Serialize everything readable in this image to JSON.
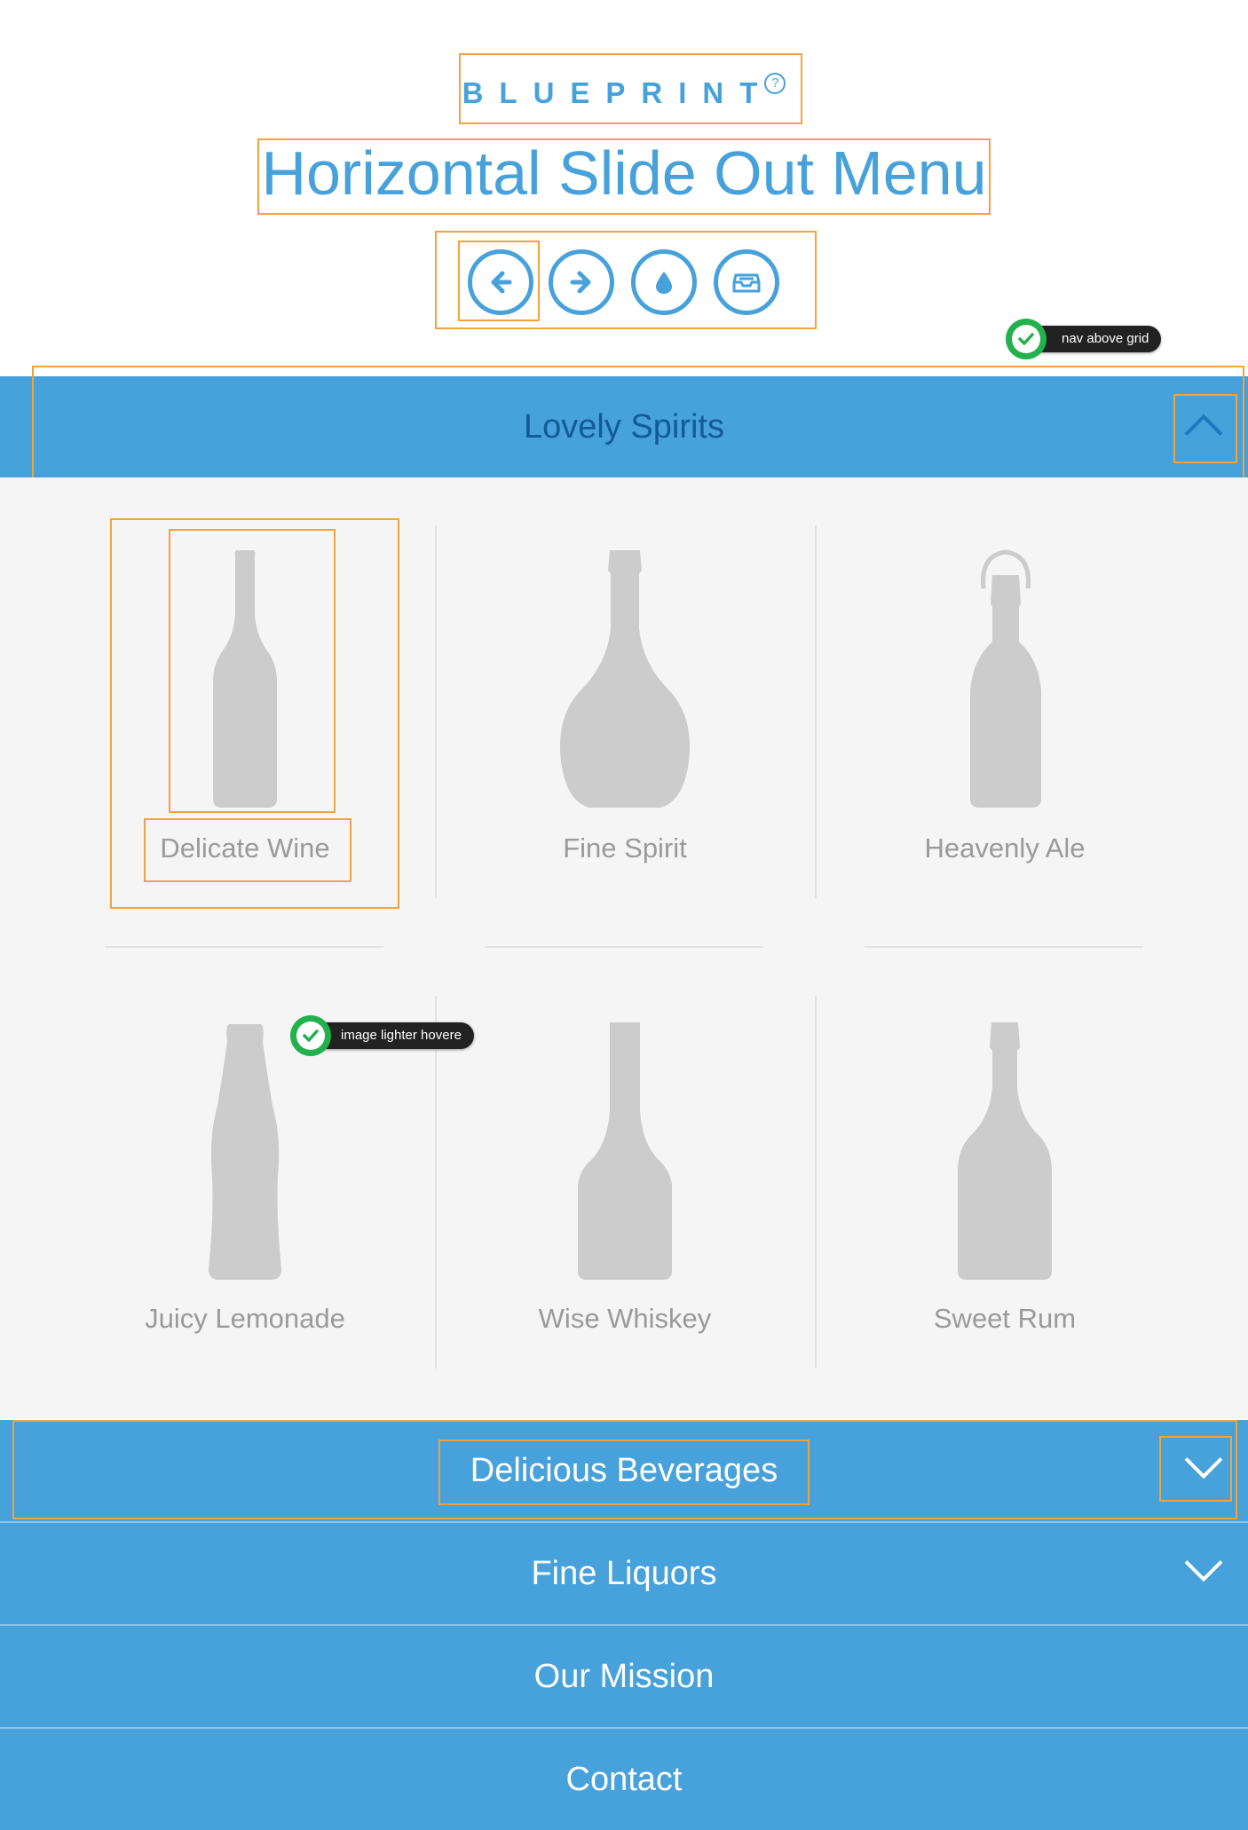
{
  "header": {
    "brand": "BLUEPRINT",
    "brand_help": "?",
    "title": "Horizontal Slide Out Menu",
    "nav_icons": [
      "arrow-left-icon",
      "arrow-right-icon",
      "drop-icon",
      "inbox-icon"
    ]
  },
  "annotations": {
    "nav_above_grid": "nav above grid",
    "image_lighter_hover": "image lighter hovere"
  },
  "menu": {
    "open_section": {
      "label": "Lovely Spirits",
      "chevron": "chevron-up-icon"
    },
    "items": [
      {
        "label": "Delicate Wine",
        "icon": "wine-bottle-icon"
      },
      {
        "label": "Fine Spirit",
        "icon": "spirit-bottle-icon"
      },
      {
        "label": "Heavenly Ale",
        "icon": "ale-bottle-icon"
      },
      {
        "label": "Juicy Lemonade",
        "icon": "lemonade-bottle-icon"
      },
      {
        "label": "Wise Whiskey",
        "icon": "whiskey-bottle-icon"
      },
      {
        "label": "Sweet Rum",
        "icon": "rum-bottle-icon"
      }
    ],
    "sections": [
      {
        "label": "Delicious Beverages",
        "chevron": "chevron-down-icon"
      },
      {
        "label": "Fine Liquors",
        "chevron": "chevron-down-icon"
      },
      {
        "label": "Our Mission"
      },
      {
        "label": "Contact"
      }
    ]
  },
  "colors": {
    "accent": "#47a1da",
    "active_label": "#0f5c96",
    "grid_bg": "#f5f5f5",
    "bottle": "#cccccc",
    "item_label": "#9a9a9a",
    "annotation_box": "#f4a23b",
    "check_green": "#22b14c"
  }
}
